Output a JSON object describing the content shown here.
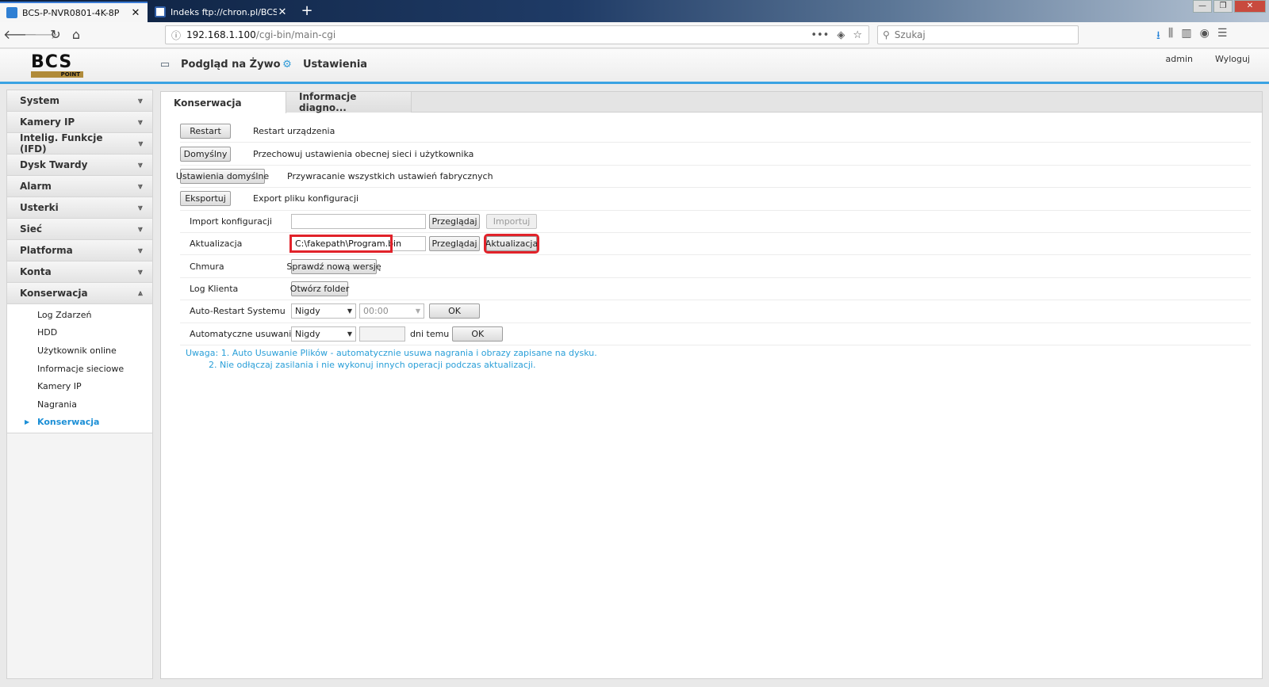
{
  "browser": {
    "tabs": [
      {
        "label": "BCS-P-NVR0801-4K-8P",
        "active": true
      },
      {
        "label": "Indeks ftp://chron.pl/BCS/FIRM",
        "active": false
      }
    ],
    "new_tab": "+",
    "url_host": "192.168.1.100",
    "url_path": "/cgi-bin/main-cgi",
    "url_more": "•••",
    "search_placeholder": "Szukaj",
    "win_controls": [
      "—",
      "❐",
      "✕"
    ]
  },
  "header": {
    "logo_text": "BCS",
    "logo_sub": "POINT",
    "nav": [
      {
        "label": "Podgląd na Żywo",
        "icon": "monitor-icon"
      },
      {
        "label": "Ustawienia",
        "icon": "gear-icon"
      }
    ],
    "user": "admin",
    "logout": "Wyloguj"
  },
  "sidebar": {
    "sections": [
      {
        "label": "System"
      },
      {
        "label": "Kamery IP"
      },
      {
        "label": "Intelig. Funkcje (IFD)"
      },
      {
        "label": "Dysk Twardy"
      },
      {
        "label": "Alarm"
      },
      {
        "label": "Usterki"
      },
      {
        "label": "Sieć"
      },
      {
        "label": "Platforma"
      },
      {
        "label": "Konta"
      },
      {
        "label": "Konserwacja"
      }
    ],
    "expanded_items": [
      {
        "label": "Log Zdarzeń"
      },
      {
        "label": "HDD"
      },
      {
        "label": "Użytkownik online"
      },
      {
        "label": "Informacje sieciowe"
      },
      {
        "label": "Kamery IP"
      },
      {
        "label": "Nagrania"
      },
      {
        "label": "Konserwacja"
      }
    ]
  },
  "main": {
    "tabs": [
      {
        "label": "Konserwacja"
      },
      {
        "label": "Informacje diagno..."
      }
    ],
    "restart": {
      "button": "Restart",
      "desc": "Restart urządzenia"
    },
    "default": {
      "button": "Domyślny",
      "desc": "Przechowuj ustawienia obecnej sieci i użytkownika"
    },
    "factory": {
      "button": "Ustawienia domyślne",
      "desc": "Przywracanie wszystkich ustawień fabrycznych"
    },
    "export": {
      "button": "Eksportuj",
      "desc": "Export pliku konfiguracji"
    },
    "import": {
      "label": "Import konfiguracji",
      "value": "",
      "browse": "Przeglądaj",
      "action": "Importuj"
    },
    "update": {
      "label": "Aktualizacja",
      "value": "C:\\fakepath\\Program.bin",
      "browse": "Przeglądaj",
      "action": "Aktualizacja"
    },
    "cloud": {
      "label": "Chmura",
      "button": "Sprawdź nową wersję"
    },
    "client_log": {
      "label": "Log Klienta",
      "button": "Otwórz folder"
    },
    "auto_restart": {
      "label": "Auto-Restart Systemu",
      "mode": "Nigdy",
      "time": "00:00",
      "ok": "OK"
    },
    "auto_delete": {
      "label": "Automatyczne usuwanie pli...",
      "mode": "Nigdy",
      "days": "",
      "days_suffix": "dni temu",
      "ok": "OK"
    },
    "note_line1": "Uwaga: 1. Auto Usuwanie Plików - automatycznie usuwa nagrania i obrazy zapisane na dysku.",
    "note_line2": "2. Nie odłączaj zasilania i nie wykonuj innych operacji podczas aktualizacji."
  }
}
